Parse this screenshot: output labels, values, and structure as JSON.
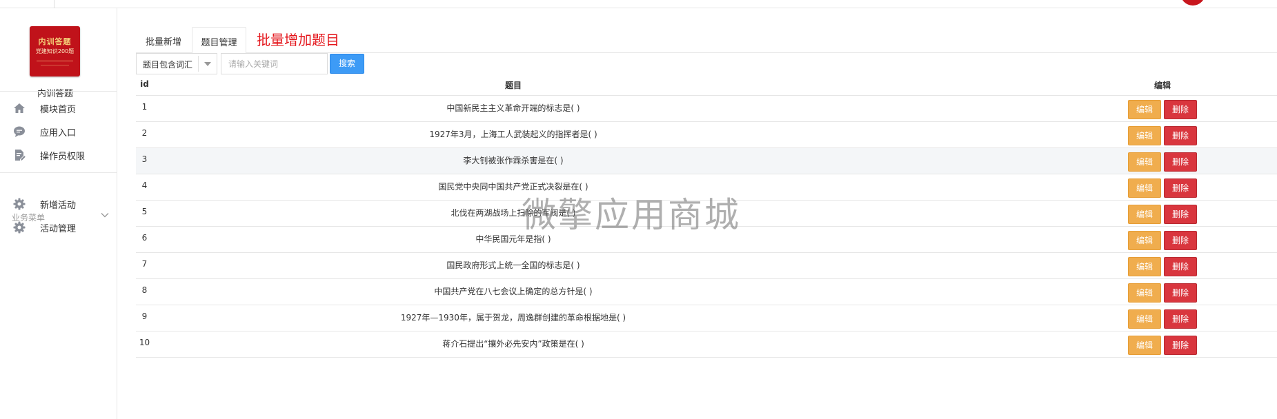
{
  "app": {
    "name": "内训答题",
    "logo_line1": "内训答题",
    "logo_line2": "党建知识200题"
  },
  "sidebar": {
    "items": [
      {
        "label": "模块首页",
        "icon": "home-icon"
      },
      {
        "label": "应用入口",
        "icon": "chat-icon"
      },
      {
        "label": "操作员权限",
        "icon": "document-edit-icon"
      }
    ],
    "section_title": "业务菜单",
    "section_items": [
      {
        "label": "新增活动",
        "icon": "gear-icon"
      },
      {
        "label": "活动管理",
        "icon": "gear-icon"
      }
    ]
  },
  "tabs": [
    {
      "label": "批量新增"
    },
    {
      "label": "题目管理"
    }
  ],
  "page_heading": "批量增加题目",
  "search": {
    "select_value": "题目包含词汇",
    "placeholder": "请输入关键词",
    "button_label": "搜索"
  },
  "table": {
    "headers": {
      "id": "id",
      "question": "题目",
      "actions": "编辑"
    },
    "edit_label": "编辑",
    "delete_label": "删除",
    "rows": [
      {
        "id": "1",
        "question": "中国新民主主义革命开端的标志是( )"
      },
      {
        "id": "2",
        "question": "1927年3月，上海工人武装起义的指挥者是( )"
      },
      {
        "id": "3",
        "question": "李大钊被张作霖杀害是在( )"
      },
      {
        "id": "4",
        "question": "国民党中央同中国共产党正式决裂是在( )"
      },
      {
        "id": "5",
        "question": "北伐在两湖战场上扫除的军阀是( )"
      },
      {
        "id": "6",
        "question": "中华民国元年是指( )"
      },
      {
        "id": "7",
        "question": "国民政府形式上统一全国的标志是( )"
      },
      {
        "id": "8",
        "question": "中国共产党在八七会议上确定的总方针是( )"
      },
      {
        "id": "9",
        "question": "1927年—1930年，属于贺龙，周逸群创建的革命根据地是( )"
      },
      {
        "id": "10",
        "question": "蒋介石提出“攘外必先安内”政策是在( )"
      }
    ]
  },
  "watermark": "微擎应用商城",
  "colors": {
    "accent_red": "#e4151b",
    "primary_blue": "#3d9bf6",
    "edit_orange": "#f0ad4e",
    "delete_red": "#d9363e"
  }
}
